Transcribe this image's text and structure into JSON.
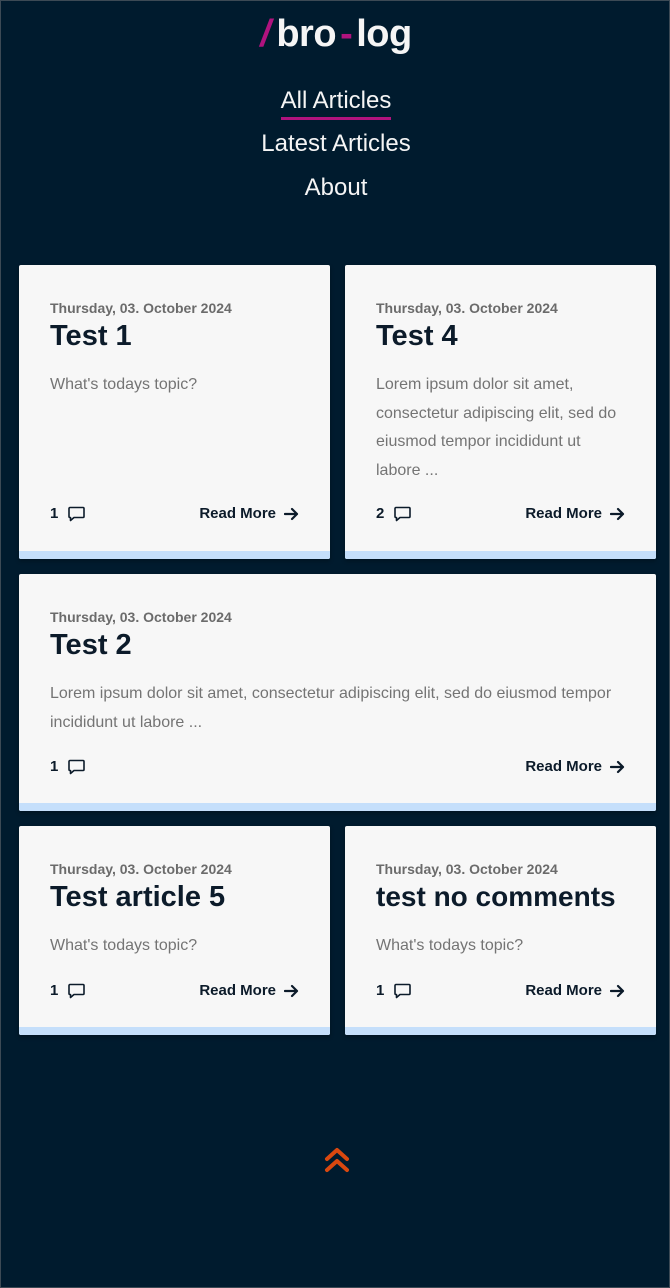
{
  "brand": {
    "slash": "/",
    "part1": "bro",
    "dash": "-",
    "part2": "log"
  },
  "nav": {
    "items": [
      {
        "label": "All Articles",
        "active": true
      },
      {
        "label": "Latest Articles",
        "active": false
      },
      {
        "label": "About",
        "active": false
      }
    ]
  },
  "articles": [
    {
      "date": "Thursday, 03. October 2024",
      "title": "Test 1",
      "excerpt": "What's todays topic?",
      "comments": "1",
      "read_more": "Read More"
    },
    {
      "date": "Thursday, 03. October 2024",
      "title": "Test 4",
      "excerpt": "Lorem ipsum dolor sit amet, consectetur adipiscing elit, sed do eiusmod tempor incididunt ut labore ...",
      "comments": "2",
      "read_more": "Read More"
    },
    {
      "date": "Thursday, 03. October 2024",
      "title": "Test 2",
      "excerpt": "Lorem ipsum dolor sit amet, consectetur adipiscing elit, sed do eiusmod tempor incididunt ut labore ...",
      "comments": "1",
      "read_more": "Read More"
    },
    {
      "date": "Thursday, 03. October 2024",
      "title": "Test article 5",
      "excerpt": "What's todays topic?",
      "comments": "1",
      "read_more": "Read More"
    },
    {
      "date": "Thursday, 03. October 2024",
      "title": "test no comments",
      "excerpt": "What's todays topic?",
      "comments": "1",
      "read_more": "Read More"
    }
  ],
  "icons": {
    "comment": "comment-icon",
    "arrow": "arrow-right-icon",
    "scroll_top": "double-chevron-up-icon"
  },
  "colors": {
    "background": "#001b2e",
    "accent": "#b0137e",
    "card": "#f7f7f7",
    "card_bar": "#c5dffb",
    "scroll_top": "#d9480f"
  }
}
